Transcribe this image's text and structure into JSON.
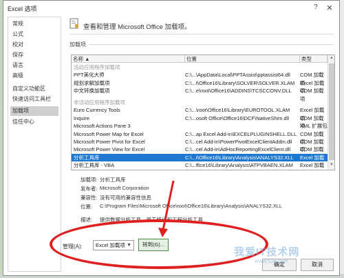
{
  "window": {
    "title": "Excel 选项",
    "help": "?",
    "close": "✕"
  },
  "sidebar": {
    "items": [
      {
        "label": "常规"
      },
      {
        "label": "公式"
      },
      {
        "label": "校对"
      },
      {
        "label": "保存"
      },
      {
        "label": "语言"
      },
      {
        "label": "高级"
      },
      {
        "label": "自定义功能区"
      },
      {
        "label": "快速访问工具栏"
      },
      {
        "label": "加载项",
        "active": true
      },
      {
        "label": "信任中心"
      }
    ]
  },
  "header": {
    "title": "查看和管理 Microsoft Office 加载项。"
  },
  "addins": {
    "section_label": "加载项",
    "columns": [
      "名称 ▲",
      "位置",
      "类型"
    ],
    "groups": {
      "active": "活动应用程序加载项",
      "inactive": "非活动应用程序加载项"
    },
    "active_rows": [
      {
        "name": "PPT美化大师",
        "location": "C:\\...\\AppData\\Local\\PPTAssist\\pptassist64.dll",
        "type": "COM 加载项"
      },
      {
        "name": "规划求解加载项",
        "location": "C:\\...t\\Office16\\Library\\SOLVER\\SOLVER.XLAM",
        "type": "Excel 加载项"
      },
      {
        "name": "中文转换加载项",
        "location": "C:\\...e\\root\\Office16\\ADDINS\\TCSCCONV.DLL",
        "type": "COM 加载项"
      }
    ],
    "inactive_rows": [
      {
        "name": "Euro Currency Tools",
        "location": "C:\\...\\root\\Office16\\Library\\EUROTOOL.XLAM",
        "type": "Excel 加载项"
      },
      {
        "name": "Inquire",
        "location": "C:\\...osoft Office\\Office16\\DCF\\NativeShim.dll",
        "type": "COM 加载项"
      },
      {
        "name": "Microsoft Actions Pane 3",
        "location": "",
        "type": "XML 扩展包"
      },
      {
        "name": "Microsoft Power Map for Excel",
        "location": "C:\\...ap Excel Add-in\\EXCELPLUGINSHELL.DLL",
        "type": "COM 加载项"
      },
      {
        "name": "Microsoft Power Pivot for Excel",
        "location": "C:\\...cel Add-in\\PowerPivotExcelClientAddIn.dll",
        "type": "COM 加载项"
      },
      {
        "name": "Microsoft Power View for Excel",
        "location": "C:\\...cel Add-in\\AdHocReportingExcelClient.dll",
        "type": "COM 加载项"
      },
      {
        "name": "分析工具库",
        "location": "C:\\...t\\Office16\\Library\\Analysis\\ANALYS32.XLL",
        "type": "Excel 加载项",
        "selected": true
      },
      {
        "name": "分析工具库 - VBA",
        "location": "C:\\...ffice16\\Library\\Analysis\\ATPVBAEN.XLAM",
        "type": "Excel 加载项"
      }
    ]
  },
  "details": {
    "addin_label": "加载项:",
    "addin_value": "分析工具库",
    "publisher_label": "发布者:",
    "publisher_value": "Microsoft Corporation",
    "compat_label": "兼容性:",
    "compat_value": "没有可用的兼容性信息",
    "location_label": "位置:",
    "location_value": "C:\\Program Files\\Microsoft Office\\root\\Office16\\Library\\Analysis\\ANALYS32.XLL",
    "desc_label": "描述:",
    "desc_value": "提供数据分析工具，用于统计和工程分析工具"
  },
  "manage": {
    "label": "管理(A):",
    "selected": "Excel 加载项",
    "goto_label": "转到(G)..."
  },
  "footer": {
    "ok": "确定",
    "cancel": "取消"
  },
  "watermark": {
    "text": "我爱IT技术网",
    "sub": "www.52ij.com"
  },
  "colors": {
    "selection": "#1e78d2",
    "annotation": "#e02020",
    "goto_border": "#4a8a4a"
  }
}
